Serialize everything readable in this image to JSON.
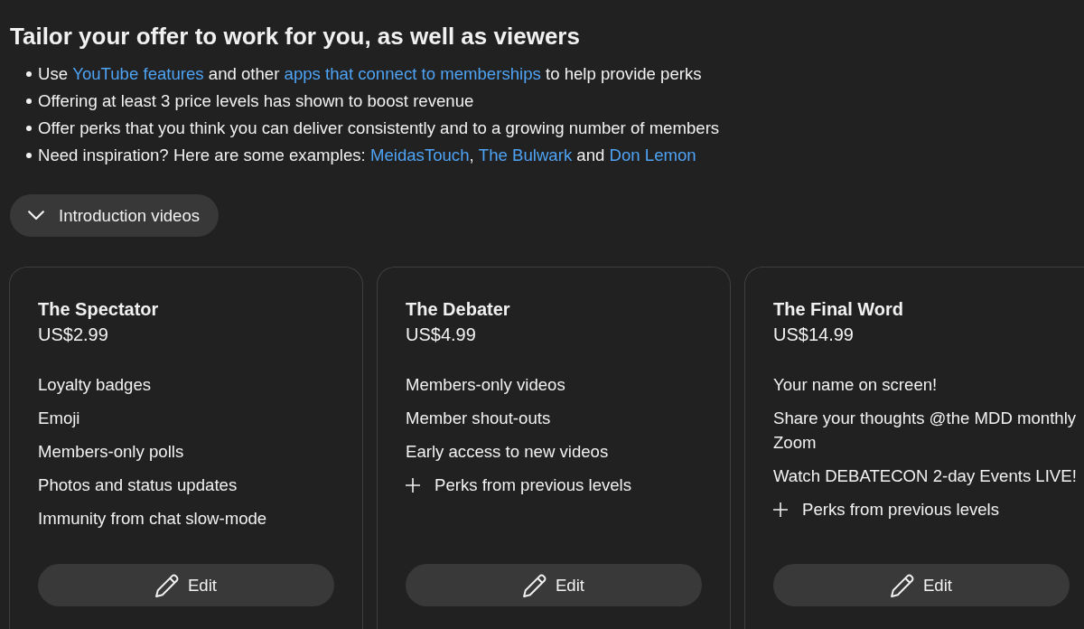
{
  "heading": "Tailor your offer to work for you, as well as viewers",
  "tips": [
    {
      "parts": [
        {
          "kind": "text",
          "text": "Use "
        },
        {
          "kind": "link",
          "text": "YouTube features"
        },
        {
          "kind": "text",
          "text": " and other "
        },
        {
          "kind": "link",
          "text": "apps that connect to memberships"
        },
        {
          "kind": "text",
          "text": " to help provide perks"
        }
      ]
    },
    {
      "parts": [
        {
          "kind": "text",
          "text": "Offering at least 3 price levels has shown to boost revenue"
        }
      ]
    },
    {
      "parts": [
        {
          "kind": "text",
          "text": "Offer perks that you think you can deliver consistently and to a growing number of members"
        }
      ]
    },
    {
      "parts": [
        {
          "kind": "text",
          "text": "Need inspiration? Here are some examples: "
        },
        {
          "kind": "link",
          "text": "MeidasTouch"
        },
        {
          "kind": "text",
          "text": ", "
        },
        {
          "kind": "link",
          "text": "The Bulwark"
        },
        {
          "kind": "text",
          "text": " and "
        },
        {
          "kind": "link",
          "text": "Don Lemon"
        }
      ]
    }
  ],
  "intro_toggle": {
    "label": "Introduction videos",
    "expanded": false
  },
  "levels": [
    {
      "name": "The Spectator",
      "price": "US$2.99",
      "perks": [
        {
          "kind": "perk",
          "text": "Loyalty badges"
        },
        {
          "kind": "perk",
          "text": "Emoji"
        },
        {
          "kind": "perk",
          "text": "Members-only polls"
        },
        {
          "kind": "perk",
          "text": "Photos and status updates"
        },
        {
          "kind": "perk",
          "text": "Immunity from chat slow-mode"
        }
      ],
      "edit_label": "Edit"
    },
    {
      "name": "The Debater",
      "price": "US$4.99",
      "perks": [
        {
          "kind": "perk",
          "text": "Members-only videos"
        },
        {
          "kind": "perk",
          "text": "Member shout-outs"
        },
        {
          "kind": "perk",
          "text": "Early access to new videos"
        },
        {
          "kind": "inherited",
          "text": "Perks from previous levels"
        }
      ],
      "edit_label": "Edit"
    },
    {
      "name": "The Final Word",
      "price": "US$14.99",
      "perks": [
        {
          "kind": "perk",
          "text": "Your name on screen!"
        },
        {
          "kind": "perk",
          "text": "Share your thoughts @the MDD monthly Zoom"
        },
        {
          "kind": "perk",
          "text": "Watch DEBATECON 2-day Events LIVE!"
        },
        {
          "kind": "inherited",
          "text": "Perks from previous levels"
        }
      ],
      "edit_label": "Edit"
    }
  ]
}
